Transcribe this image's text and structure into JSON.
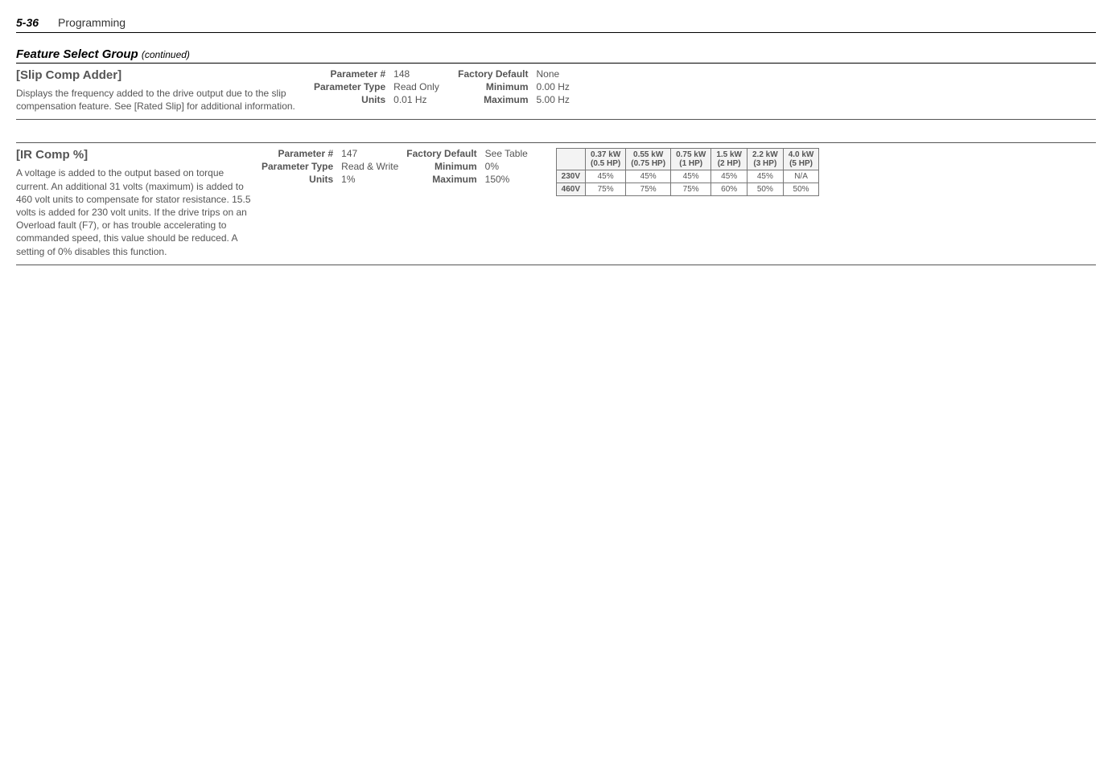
{
  "header": {
    "page_num": "5-36",
    "section": "Programming"
  },
  "group": {
    "title": "Feature Select Group",
    "continued": "(continued)"
  },
  "param1": {
    "name": "[Slip Comp Adder]",
    "description": "Displays the frequency added to the drive output due to the slip compensation feature. See [Rated Slip] for additional information.",
    "labels": {
      "param_num": "Parameter #",
      "param_type": "Parameter Type",
      "units": "Units",
      "factory_default": "Factory Default",
      "minimum": "Minimum",
      "maximum": "Maximum"
    },
    "values": {
      "param_num": "148",
      "param_type": "Read Only",
      "units": "0.01 Hz",
      "factory_default": "None",
      "minimum": "0.00 Hz",
      "maximum": "5.00 Hz"
    }
  },
  "param2": {
    "name": "[IR Comp %]",
    "description": "A voltage is added to the output based on torque current. An additional 31 volts (maximum) is added to 460 volt units to compensate for stator resistance. 15.5 volts is added for 230 volt units. If the drive trips on an Overload fault (F7), or has trouble accelerating to commanded speed, this value should be reduced. A setting of 0% disables this function.",
    "labels": {
      "param_num": "Parameter #",
      "param_type": "Parameter Type",
      "units": "Units",
      "factory_default": "Factory Default",
      "minimum": "Minimum",
      "maximum": "Maximum"
    },
    "values": {
      "param_num": "147",
      "param_type": "Read & Write",
      "units": "1%",
      "factory_default": "See Table",
      "minimum": "0%",
      "maximum": "150%"
    }
  },
  "chart_data": {
    "type": "table",
    "columns": [
      {
        "top": "0.37 kW",
        "sub": "(0.5 HP)"
      },
      {
        "top": "0.55 kW",
        "sub": "(0.75 HP)"
      },
      {
        "top": "0.75 kW",
        "sub": "(1 HP)"
      },
      {
        "top": "1.5 kW",
        "sub": "(2 HP)"
      },
      {
        "top": "2.2 kW",
        "sub": "(3 HP)"
      },
      {
        "top": "4.0 kW",
        "sub": "(5 HP)"
      }
    ],
    "rows": [
      {
        "label": "230V",
        "values": [
          "45%",
          "45%",
          "45%",
          "45%",
          "45%",
          "N/A"
        ]
      },
      {
        "label": "460V",
        "values": [
          "75%",
          "75%",
          "75%",
          "60%",
          "50%",
          "50%"
        ]
      }
    ]
  }
}
